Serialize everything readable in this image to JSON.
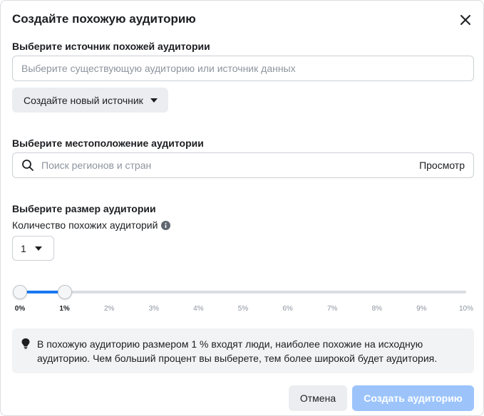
{
  "dialog": {
    "title": "Создайте похожую аудиторию",
    "close_icon": "close-icon"
  },
  "source": {
    "label": "Выберите источник похожей аудитории",
    "placeholder": "Выберите существующую аудиторию или источник данных",
    "value": "",
    "create_button_label": "Создайте новый источник"
  },
  "location": {
    "label": "Выберите местоположение аудитории",
    "placeholder": "Поиск регионов и стран",
    "value": "",
    "browse_label": "Просмотр",
    "search_icon": "search-icon"
  },
  "size": {
    "label": "Выберите размер аудитории",
    "count_label": "Количество похожих аудиторий",
    "info_icon": "info-icon",
    "count_value": "1",
    "slider": {
      "min_percent": 0,
      "max_percent": 10,
      "selected_start_percent": 0,
      "selected_end_percent": 1,
      "ticks": [
        "0%",
        "1%",
        "2%",
        "3%",
        "4%",
        "5%",
        "6%",
        "7%",
        "8%",
        "9%",
        "10%"
      ]
    },
    "note": "В похожую аудиторию размером 1 % входят люди, наиболее похожие на исходную аудиторию. Чем больший процент вы выберете, тем более широкой будет аудитория.",
    "note_icon": "lightbulb-icon"
  },
  "footer": {
    "cancel_label": "Отмена",
    "create_label": "Создать аудиторию"
  },
  "colors": {
    "accent": "#1877f2",
    "primary_disabled": "#9cc4fb",
    "secondary_button": "#ebedf0",
    "note_background": "#f2f3f5"
  }
}
